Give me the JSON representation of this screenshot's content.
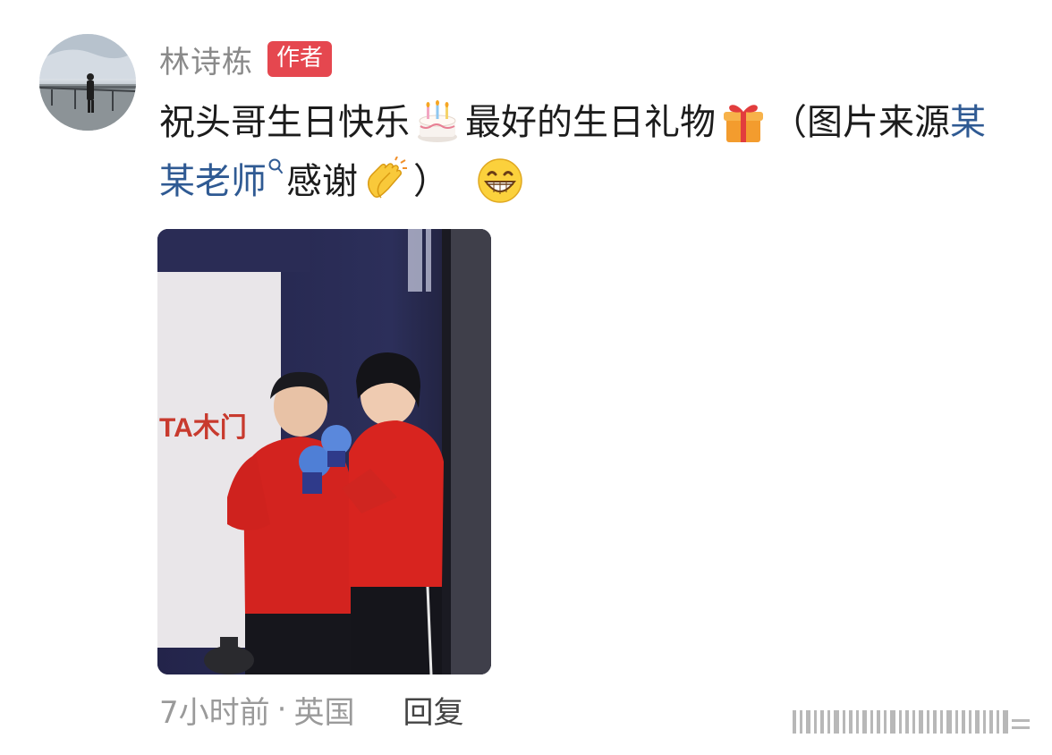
{
  "author": {
    "name": "林诗栋",
    "badge": "作者"
  },
  "content": {
    "text_1": "祝头哥生日快乐",
    "emoji_1": "birthday-cake",
    "text_2": "最好的生日礼物",
    "emoji_2": "gift",
    "text_3": "（图片来源",
    "link_text": "某某老师",
    "text_4": "感谢",
    "emoji_3": "clapping-hands",
    "text_5": "）",
    "emoji_4": "grinning-face"
  },
  "meta": {
    "time": "7小时前",
    "separator": "·",
    "location": "英国",
    "reply_label": "回复"
  },
  "colors": {
    "badge": "#e5474f",
    "link": "#2f5a93",
    "muted": "#9a9a9a"
  }
}
